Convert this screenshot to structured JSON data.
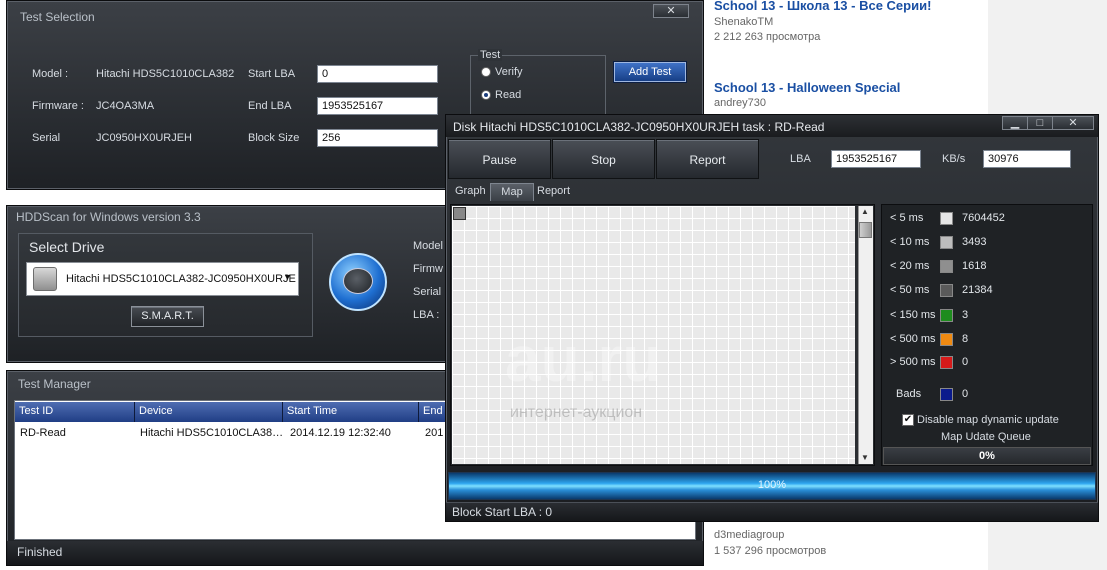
{
  "web": {
    "videos": [
      {
        "title": "School 13 - Школа 13 - Все Серии!",
        "channel": "ShenakoTM",
        "views": "2 212 263 просмотра"
      },
      {
        "title": "School 13 - Halloween Special",
        "channel": "andrey730",
        "views": ""
      },
      {
        "title": "",
        "channel": "d3mediagroup",
        "views": "1 537 296 просмотров"
      }
    ]
  },
  "test_selection": {
    "title": "Test Selection",
    "close_label": "✕",
    "model_label": "Model :",
    "model_value": "Hitachi HDS5C1010CLA382",
    "firmware_label": "Firmware :",
    "firmware_value": "JC4OA3MA",
    "serial_label": "Serial",
    "serial_value": "JC0950HX0URJEH",
    "start_lba_label": "Start LBA",
    "start_lba_value": "0",
    "end_lba_label": "End LBA",
    "end_lba_value": "1953525167",
    "block_size_label": "Block Size",
    "block_size_value": "256",
    "test_group_label": "Test",
    "options": [
      {
        "label": "Verify",
        "selected": false
      },
      {
        "label": "Read",
        "selected": true
      }
    ],
    "add_test_label": "Add Test"
  },
  "hddscan": {
    "title": "HDDScan for Windows version 3.3",
    "select_drive_label": "Select Drive",
    "drive_value": "Hitachi HDS5C1010CLA382-JC0950HX0URJE",
    "smart_label": "S.M.A.R.T.",
    "info_labels": [
      "Model",
      "Firmw",
      "Serial",
      "LBA :"
    ]
  },
  "test_manager": {
    "title": "Test Manager",
    "columns": [
      "Test ID",
      "Device",
      "Start Time",
      "End"
    ],
    "rows": [
      {
        "id": "RD-Read",
        "device": "Hitachi HDS5C1010CLA38…",
        "start": "2014.12.19 12:32:40",
        "end": "201"
      }
    ],
    "status": "Finished"
  },
  "disk_window": {
    "title": "Disk Hitachi HDS5C1010CLA382-JC0950HX0URJEH   task : RD-Read",
    "buttons": [
      "Pause",
      "Stop",
      "Report"
    ],
    "lba_label": "LBA",
    "lba_value": "1953525167",
    "kbs_label": "KB/s",
    "kbs_value": "30976",
    "tabs": [
      "Graph",
      "Map",
      "Report"
    ],
    "active_tab": "Map",
    "legend": [
      {
        "label": "< 5 ms",
        "value": "7604452",
        "color": "#e6e6e6"
      },
      {
        "label": "< 10 ms",
        "value": "3493",
        "color": "#bdbdbd"
      },
      {
        "label": "< 20 ms",
        "value": "1618",
        "color": "#8f8f8f"
      },
      {
        "label": "< 50 ms",
        "value": "21384",
        "color": "#5a5a5a"
      },
      {
        "label": "< 150 ms",
        "value": "3",
        "color": "#1e8c1e"
      },
      {
        "label": "< 500 ms",
        "value": "8",
        "color": "#ef8a12"
      },
      {
        "label": "> 500 ms",
        "value": "0",
        "color": "#d61a1a"
      },
      {
        "label": "Bads",
        "value": "0",
        "color": "#0a1a8c"
      }
    ],
    "disable_map_label": "Disable map dynamic update",
    "disable_map_checked": true,
    "queue_label": "Map Udate Queue",
    "queue_percent": "0%",
    "progress_text": "100%",
    "progress_fraction": 1.0,
    "status_text": "Block Start LBA : 0",
    "watermark_main": "au.ru",
    "watermark_sub": "интернет-аукцион"
  }
}
